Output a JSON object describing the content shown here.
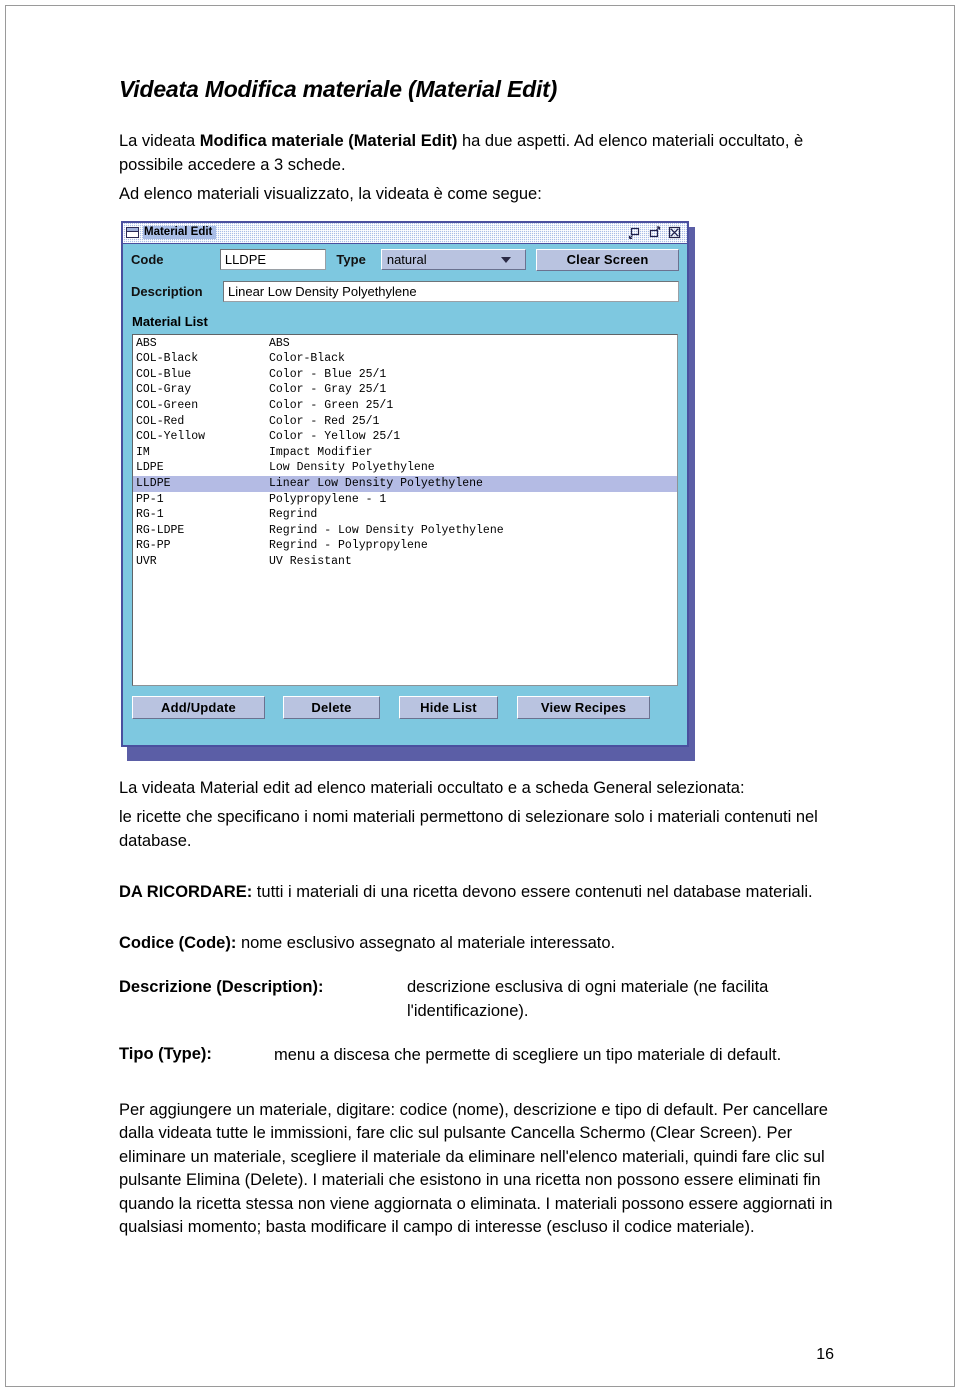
{
  "document": {
    "title": "Videata Modifica materiale (Material Edit)",
    "intro_line1_pre": "La videata ",
    "intro_line1_bold": "Modifica materiale (Material Edit)",
    "intro_line1_post": " ha due aspetti.  Ad elenco materiali occultato, è possibile accedere a 3 schede.",
    "intro_line2": "Ad elenco materiali visualizzato, la videata è come segue:",
    "caption_line1": "La videata Material edit ad elenco materiali occultato e a scheda General selezionata:",
    "caption_line2": "le ricette che specificano i nomi materiali permettono di selezionare solo i materiali contenuti nel database.",
    "remember_label": "DA RICORDARE:",
    "remember_text": " tutti i materiali di una ricetta devono essere contenuti nel database materiali.",
    "definitions": [
      {
        "term": "Codice (Code):",
        "body": "nome esclusivo assegnato al materiale interessato.",
        "layout": "inline"
      },
      {
        "term": "Descrizione (Description):",
        "body": "descrizione esclusiva di ogni materiale (ne facilita l'identificazione).",
        "layout": "indent-desc"
      },
      {
        "term": "Tipo (Type):",
        "body": "menu a discesa che permette di scegliere un tipo materiale di default.",
        "layout": "indent-tipo"
      }
    ],
    "closing_paragraph": "Per aggiungere un materiale, digitare:  codice (nome), descrizione e tipo di default.  Per cancellare dalla videata tutte le immissioni, fare clic sul pulsante Cancella Schermo (Clear Screen).  Per eliminare un materiale, scegliere il materiale da eliminare nell'elenco materiali, quindi fare clic sul pulsante Elimina (Delete).  I materiali che esistono in una ricetta non possono essere eliminati fin quando la ricetta stessa non viene aggiornata o eliminata.  I materiali possono essere aggiornati in qualsiasi momento; basta modificare il campo di interesse (escluso il codice materiale).",
    "page_number": "16"
  },
  "window": {
    "title": "Material Edit",
    "titlebar_buttons": [
      {
        "name": "minimize",
        "label": "Minimize"
      },
      {
        "name": "maximize",
        "label": "Maximize"
      },
      {
        "name": "close",
        "label": "Close"
      }
    ],
    "fields": {
      "code_label": "Code",
      "code_value": "LLDPE",
      "type_label": "Type",
      "type_value": "natural",
      "description_label": "Description",
      "description_value": "Linear Low Density Polyethylene"
    },
    "clear_screen_label": "Clear Screen",
    "material_list_label": "Material List",
    "material_list": [
      {
        "code": "ABS",
        "description": "ABS",
        "selected": false
      },
      {
        "code": "COL-Black",
        "description": "Color-Black",
        "selected": false
      },
      {
        "code": "COL-Blue",
        "description": "Color - Blue 25/1",
        "selected": false
      },
      {
        "code": "COL-Gray",
        "description": "Color - Gray 25/1",
        "selected": false
      },
      {
        "code": "COL-Green",
        "description": "Color - Green 25/1",
        "selected": false
      },
      {
        "code": "COL-Red",
        "description": "Color - Red 25/1",
        "selected": false
      },
      {
        "code": "COL-Yellow",
        "description": "Color - Yellow 25/1",
        "selected": false
      },
      {
        "code": "IM",
        "description": "Impact Modifier",
        "selected": false
      },
      {
        "code": "LDPE",
        "description": "Low Density Polyethylene",
        "selected": false
      },
      {
        "code": "LLDPE",
        "description": "Linear Low Density Polyethylene",
        "selected": true
      },
      {
        "code": "PP-1",
        "description": "Polypropylene - 1",
        "selected": false
      },
      {
        "code": "RG-1",
        "description": "Regrind",
        "selected": false
      },
      {
        "code": "RG-LDPE",
        "description": "Regrind - Low Density Polyethylene",
        "selected": false
      },
      {
        "code": "RG-PP",
        "description": "Regrind - Polypropylene",
        "selected": false
      },
      {
        "code": "UVR",
        "description": "UV Resistant",
        "selected": false
      }
    ],
    "buttons": [
      {
        "label": "Add/Update",
        "cls": "b-add"
      },
      {
        "label": "Delete",
        "cls": "b-del"
      },
      {
        "label": "Hide List",
        "cls": "b-hide"
      },
      {
        "label": "View Recipes",
        "cls": "b-recipe"
      }
    ],
    "colors": {
      "window_background": "#7ec8e0",
      "window_border": "#4a4f9e",
      "titlebar": "#a9bde6",
      "button_face": "#b9c3e0",
      "selected_row": "#b4bbe4"
    }
  }
}
